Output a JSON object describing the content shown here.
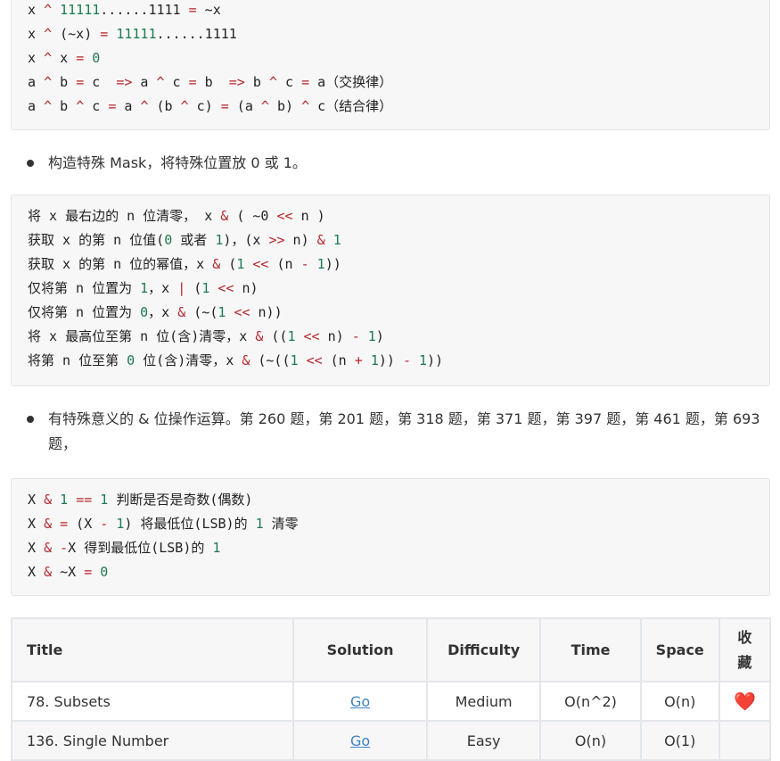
{
  "code_blocks": [
    [
      [
        [
          "x ",
          ""
        ],
        [
          "^",
          "o"
        ],
        [
          " ",
          ""
        ],
        [
          "11111",
          "n"
        ],
        [
          "......1111 ",
          ""
        ],
        [
          "=",
          "o"
        ],
        [
          " ~x",
          ""
        ]
      ],
      [
        [
          "x ",
          ""
        ],
        [
          "^",
          "o"
        ],
        [
          " (~x) ",
          ""
        ],
        [
          "=",
          "o"
        ],
        [
          " ",
          ""
        ],
        [
          "11111",
          "n"
        ],
        [
          "......1111",
          ""
        ]
      ],
      [
        [
          "x ",
          ""
        ],
        [
          "^",
          "o"
        ],
        [
          " x ",
          ""
        ],
        [
          "=",
          "o"
        ],
        [
          " ",
          ""
        ],
        [
          "0",
          "n"
        ]
      ],
      [
        [
          "a ",
          ""
        ],
        [
          "^",
          "o"
        ],
        [
          " b ",
          ""
        ],
        [
          "=",
          "o"
        ],
        [
          " c  ",
          ""
        ],
        [
          "=>",
          "o"
        ],
        [
          " a ",
          ""
        ],
        [
          "^",
          "o"
        ],
        [
          " c ",
          ""
        ],
        [
          "=",
          "o"
        ],
        [
          " b  ",
          ""
        ],
        [
          "=>",
          "o"
        ],
        [
          " b ",
          ""
        ],
        [
          "^",
          "o"
        ],
        [
          " c ",
          ""
        ],
        [
          "=",
          "o"
        ],
        [
          " a（交换律）",
          ""
        ]
      ],
      [
        [
          "a ",
          ""
        ],
        [
          "^",
          "o"
        ],
        [
          " b ",
          ""
        ],
        [
          "^",
          "o"
        ],
        [
          " c ",
          ""
        ],
        [
          "=",
          "o"
        ],
        [
          " a ",
          ""
        ],
        [
          "^",
          "o"
        ],
        [
          " (b ",
          ""
        ],
        [
          "^",
          "o"
        ],
        [
          " c) ",
          ""
        ],
        [
          "=",
          "o"
        ],
        [
          " (a ",
          ""
        ],
        [
          "^",
          "o"
        ],
        [
          " b) ",
          ""
        ],
        [
          "^",
          "o"
        ],
        [
          " c（结合律）",
          ""
        ]
      ]
    ],
    [
      [
        [
          "将 x 最右边的 n 位清零， x ",
          ""
        ],
        [
          "&",
          "o"
        ],
        [
          " ( ~0 ",
          ""
        ],
        [
          "<<",
          "o"
        ],
        [
          " n )",
          ""
        ]
      ],
      [
        [
          "获取 x 的第 n 位值(",
          ""
        ],
        [
          "0",
          "n"
        ],
        [
          " 或者 ",
          ""
        ],
        [
          "1",
          "n"
        ],
        [
          ")，(x ",
          ""
        ],
        [
          ">>",
          "o"
        ],
        [
          " n) ",
          ""
        ],
        [
          "&",
          "o"
        ],
        [
          " ",
          ""
        ],
        [
          "1",
          "n"
        ]
      ],
      [
        [
          "获取 x 的第 n 位的幂值，x ",
          ""
        ],
        [
          "&",
          "o"
        ],
        [
          " (",
          ""
        ],
        [
          "1",
          "n"
        ],
        [
          " ",
          ""
        ],
        [
          "<<",
          "o"
        ],
        [
          " (n ",
          ""
        ],
        [
          "-",
          "o"
        ],
        [
          " ",
          ""
        ],
        [
          "1",
          "n"
        ],
        [
          "))",
          ""
        ]
      ],
      [
        [
          "仅将第 n 位置为 ",
          ""
        ],
        [
          "1",
          "n"
        ],
        [
          "，x ",
          ""
        ],
        [
          "|",
          "o"
        ],
        [
          " (",
          ""
        ],
        [
          "1",
          "n"
        ],
        [
          " ",
          ""
        ],
        [
          "<<",
          "o"
        ],
        [
          " n)",
          ""
        ]
      ],
      [
        [
          "仅将第 n 位置为 ",
          ""
        ],
        [
          "0",
          "n"
        ],
        [
          "，x ",
          ""
        ],
        [
          "&",
          "o"
        ],
        [
          " (~(",
          ""
        ],
        [
          "1",
          "n"
        ],
        [
          " ",
          ""
        ],
        [
          "<<",
          "o"
        ],
        [
          " n))",
          ""
        ]
      ],
      [
        [
          "将 x 最高位至第 n 位(含)清零，x ",
          ""
        ],
        [
          "&",
          "o"
        ],
        [
          " ((",
          ""
        ],
        [
          "1",
          "n"
        ],
        [
          " ",
          ""
        ],
        [
          "<<",
          "o"
        ],
        [
          " n) ",
          ""
        ],
        [
          "-",
          "o"
        ],
        [
          " ",
          ""
        ],
        [
          "1",
          "n"
        ],
        [
          ")",
          ""
        ]
      ],
      [
        [
          "将第 n 位至第 ",
          ""
        ],
        [
          "0",
          "n"
        ],
        [
          " 位(含)清零，x ",
          ""
        ],
        [
          "&",
          "o"
        ],
        [
          " (~((",
          ""
        ],
        [
          "1",
          "n"
        ],
        [
          " ",
          ""
        ],
        [
          "<<",
          "o"
        ],
        [
          " (n ",
          ""
        ],
        [
          "+",
          "o"
        ],
        [
          " ",
          ""
        ],
        [
          "1",
          "n"
        ],
        [
          ")) ",
          ""
        ],
        [
          "-",
          "o"
        ],
        [
          " ",
          ""
        ],
        [
          "1",
          "n"
        ],
        [
          "))",
          ""
        ]
      ]
    ],
    [
      [
        [
          "X ",
          ""
        ],
        [
          "&",
          "o"
        ],
        [
          " ",
          ""
        ],
        [
          "1",
          "n"
        ],
        [
          " ",
          ""
        ],
        [
          "==",
          "o"
        ],
        [
          " ",
          ""
        ],
        [
          "1",
          "n"
        ],
        [
          " 判断是否是奇数(偶数)",
          ""
        ]
      ],
      [
        [
          "X ",
          ""
        ],
        [
          "&",
          "o"
        ],
        [
          " ",
          ""
        ],
        [
          "=",
          "o"
        ],
        [
          " (X ",
          ""
        ],
        [
          "-",
          "o"
        ],
        [
          " ",
          ""
        ],
        [
          "1",
          "n"
        ],
        [
          ") 将最低位(LSB)的 ",
          ""
        ],
        [
          "1",
          "n"
        ],
        [
          " 清零",
          ""
        ]
      ],
      [
        [
          "X ",
          ""
        ],
        [
          "&",
          "o"
        ],
        [
          " ",
          ""
        ],
        [
          "-",
          "o"
        ],
        [
          "X 得到最低位(LSB)的 ",
          ""
        ],
        [
          "1",
          "n"
        ]
      ],
      [
        [
          "X ",
          ""
        ],
        [
          "&",
          "o"
        ],
        [
          " ~X ",
          ""
        ],
        [
          "=",
          "o"
        ],
        [
          " ",
          ""
        ],
        [
          "0",
          "n"
        ]
      ]
    ]
  ],
  "bullets": [
    "构造特殊 Mask，将特殊位置放 0 或 1。",
    "有特殊意义的 & 位操作运算。第 260 题，第 201 题，第 318 题，第 371 题，第 397 题，第 461 题，第 693 题，"
  ],
  "table": {
    "headers": [
      "Title",
      "Solution",
      "Difficulty",
      "Time",
      "Space",
      "收藏"
    ],
    "rows": [
      {
        "title": "78. Subsets",
        "solution": "Go",
        "difficulty": "Medium",
        "time": "O(n^2)",
        "space": "O(n)",
        "fav": "❤️"
      },
      {
        "title": "136. Single Number",
        "solution": "Go",
        "difficulty": "Easy",
        "time": "O(n)",
        "space": "O(1)",
        "fav": ""
      }
    ]
  },
  "colors": {
    "operator": "#b5262b",
    "number": "#1d7a4f",
    "link": "#4183c4"
  }
}
